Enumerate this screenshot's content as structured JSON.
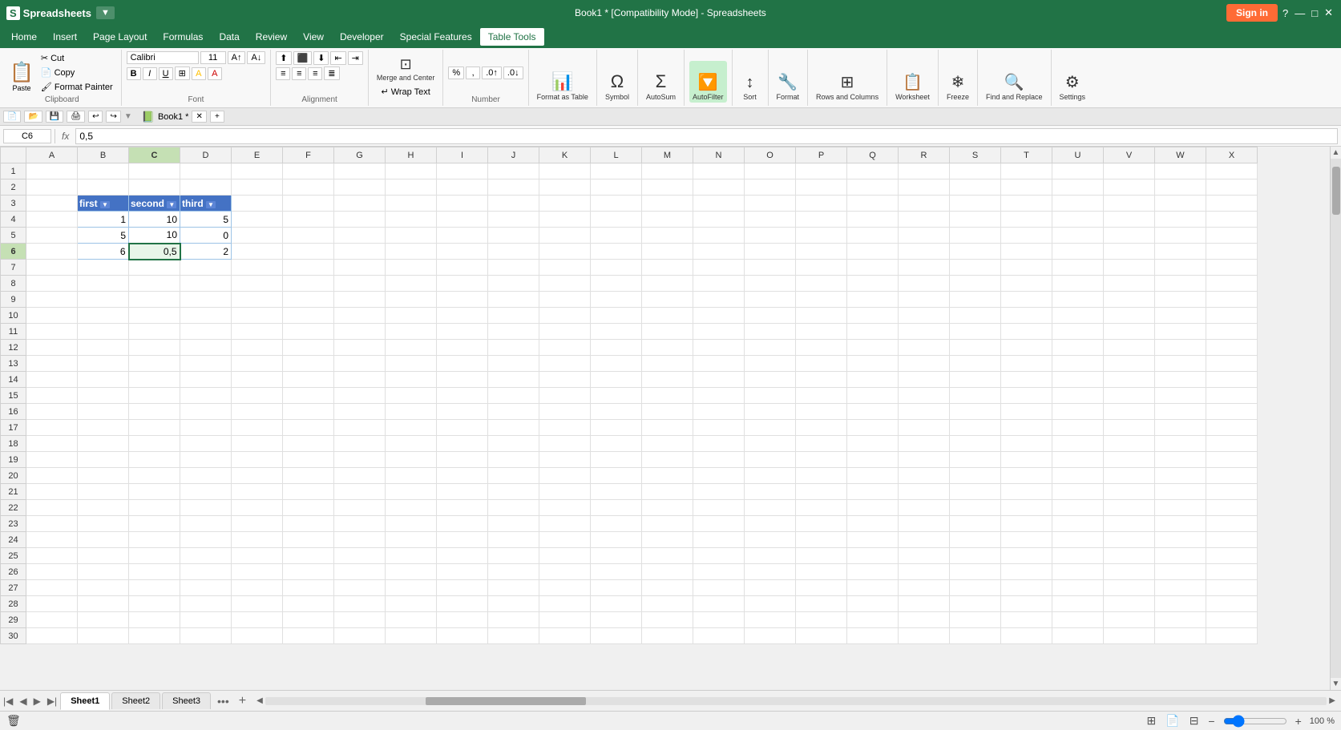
{
  "titlebar": {
    "logo": "S",
    "app_name": "Spreadsheets",
    "arrow": "▼",
    "title": "Book1 * [Compatibility Mode] - Spreadsheets",
    "sign_in": "Sign in",
    "win_controls": [
      "—",
      "□",
      "✕"
    ]
  },
  "menubar": {
    "tabs": [
      "Home",
      "Insert",
      "Page Layout",
      "Formulas",
      "Data",
      "Review",
      "View",
      "Developer",
      "Special Features",
      "Table Tools"
    ]
  },
  "ribbon": {
    "clipboard_label": "Clipboard",
    "paste_label": "Paste",
    "cut_label": "Cut",
    "copy_label": "Copy",
    "format_painter_label": "Format Painter",
    "font_label": "Font",
    "font_name": "Calibri",
    "font_size": "11",
    "alignment_label": "Alignment",
    "merge_center_label": "Merge and Center",
    "wrap_text_label": "Wrap Text",
    "number_label": "Number",
    "format_table_label": "Format as Table",
    "symbol_label": "Symbol",
    "autosum_label": "AutoSum",
    "autofilter_label": "AutoFilter",
    "sort_label": "Sort",
    "format_label": "Format",
    "rows_columns_label": "Rows and Columns",
    "worksheet_label": "Worksheet",
    "freeze_label": "Freeze",
    "find_replace_label": "Find and Replace",
    "settings_label": "Settings"
  },
  "formulabar": {
    "cell_ref": "C6",
    "fx": "fx",
    "formula_value": "0,5"
  },
  "columns": [
    "A",
    "B",
    "C",
    "D",
    "E",
    "F",
    "G",
    "H",
    "I",
    "J",
    "K",
    "L",
    "M",
    "N",
    "O",
    "P",
    "Q",
    "R",
    "S",
    "T",
    "U",
    "V",
    "W",
    "X"
  ],
  "rows": [
    1,
    2,
    3,
    4,
    5,
    6,
    7,
    8,
    9,
    10,
    11,
    12,
    13,
    14,
    15,
    16,
    17,
    18,
    19,
    20,
    21,
    22,
    23,
    24,
    25,
    26,
    27,
    28,
    29,
    30
  ],
  "table_data": {
    "header_row": 3,
    "headers": [
      {
        "col": "B",
        "label": "first"
      },
      {
        "col": "C",
        "label": "second"
      },
      {
        "col": "D",
        "label": "third"
      }
    ],
    "data_rows": [
      {
        "row": 4,
        "B": "1",
        "C": "10",
        "D": "5"
      },
      {
        "row": 5,
        "B": "5",
        "C": "10",
        "D": "0"
      },
      {
        "row": 6,
        "B": "6",
        "C": "0,5",
        "D": "2"
      }
    ],
    "selected_cell": {
      "row": 6,
      "col": "C"
    }
  },
  "sheet_tabs": {
    "sheets": [
      "Sheet1",
      "Sheet2",
      "Sheet3"
    ],
    "active": "Sheet1"
  },
  "statusbar": {
    "left": "",
    "zoom_percent": "100 %",
    "zoom_value": 100
  }
}
